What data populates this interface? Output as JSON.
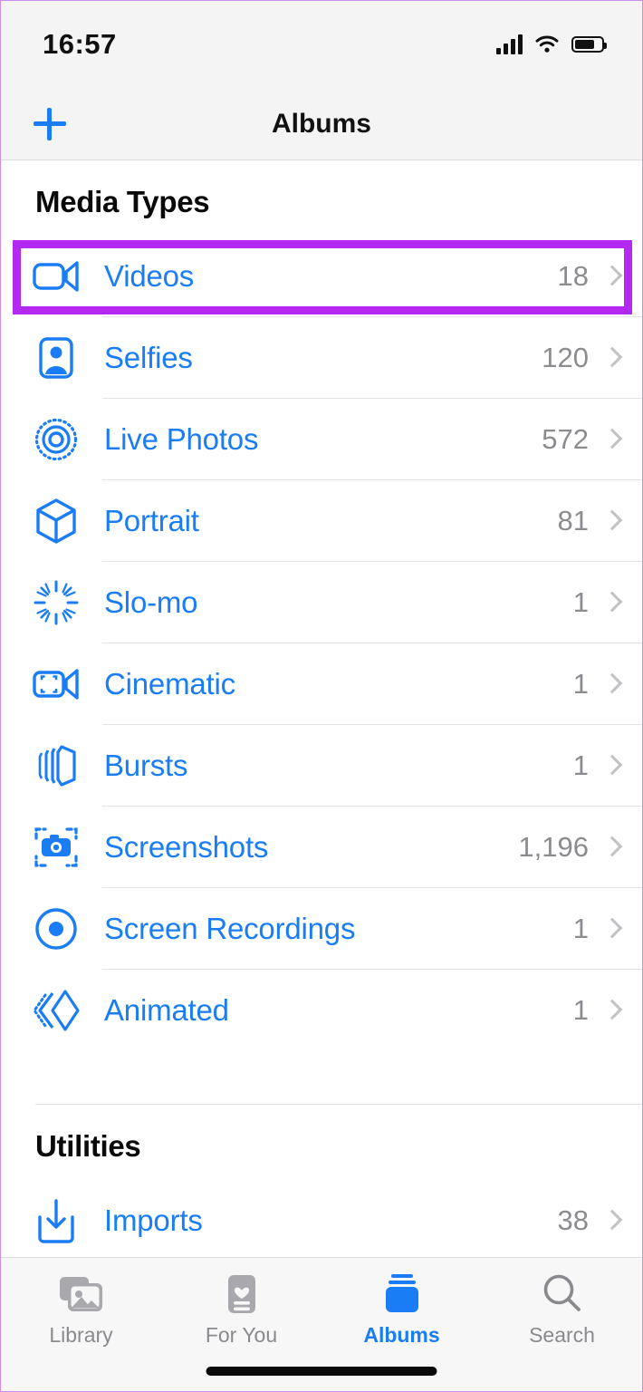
{
  "status_bar": {
    "time": "16:57",
    "signal_icon": "cellular-signal-icon",
    "wifi_icon": "wifi-icon",
    "battery_icon": "battery-icon"
  },
  "nav_bar": {
    "add_label": "+",
    "title": "Albums"
  },
  "colors": {
    "accent_blue": "#1a7df5",
    "highlight_purple": "#b429f0",
    "count_gray": "#8c8c90"
  },
  "sections": [
    {
      "header": "Media Types",
      "rows": [
        {
          "label": "Videos",
          "count": "18",
          "icon": "video-camera-icon",
          "highlighted": true
        },
        {
          "label": "Selfies",
          "count": "120",
          "icon": "person-portrait-icon",
          "highlighted": false
        },
        {
          "label": "Live Photos",
          "count": "572",
          "icon": "live-photo-icon",
          "highlighted": false
        },
        {
          "label": "Portrait",
          "count": "81",
          "icon": "cube-icon",
          "highlighted": false
        },
        {
          "label": "Slo-mo",
          "count": "1",
          "icon": "slow-motion-icon",
          "highlighted": false
        },
        {
          "label": "Cinematic",
          "count": "1",
          "icon": "cinematic-video-icon",
          "highlighted": false
        },
        {
          "label": "Bursts",
          "count": "1",
          "icon": "burst-stack-icon",
          "highlighted": false
        },
        {
          "label": "Screenshots",
          "count": "1,196",
          "icon": "screenshot-camera-icon",
          "highlighted": false
        },
        {
          "label": "Screen Recordings",
          "count": "1",
          "icon": "record-circle-icon",
          "highlighted": false
        },
        {
          "label": "Animated",
          "count": "1",
          "icon": "animated-diamond-icon",
          "highlighted": false
        }
      ]
    },
    {
      "header": "Utilities",
      "rows": [
        {
          "label": "Imports",
          "count": "38",
          "icon": "import-tray-icon",
          "highlighted": false
        }
      ]
    }
  ],
  "tab_bar": {
    "tabs": [
      {
        "label": "Library",
        "icon": "photo-stack-icon",
        "active": false
      },
      {
        "label": "For You",
        "icon": "heart-card-icon",
        "active": false
      },
      {
        "label": "Albums",
        "icon": "albums-stack-icon",
        "active": true
      },
      {
        "label": "Search",
        "icon": "magnifier-icon",
        "active": false
      }
    ]
  }
}
